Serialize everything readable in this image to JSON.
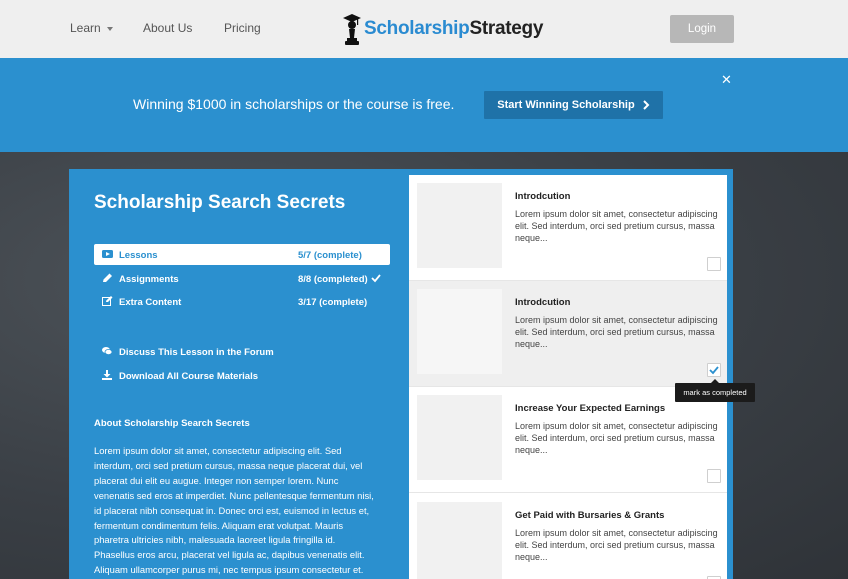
{
  "header": {
    "nav": [
      {
        "label": "Learn",
        "has_dropdown": true
      },
      {
        "label": "About Us"
      },
      {
        "label": "Pricing"
      }
    ],
    "logo_part1": "Scholarship",
    "logo_part2": "Strategy",
    "login_label": "Login"
  },
  "banner": {
    "text": "Winning $1000 in scholarships or the course is free.",
    "cta_label": "Start Winning Scholarship",
    "close_glyph": "✕"
  },
  "course": {
    "title": "Scholarship Search Secrets",
    "menu": [
      {
        "label": "Lessons",
        "count": "5/7 (complete)",
        "icon": "video-icon",
        "active": true
      },
      {
        "label": "Assignments",
        "count": "8/8 (completed)",
        "icon": "pencil-icon",
        "completed": true
      },
      {
        "label": "Extra Content",
        "count": "3/17 (complete)",
        "icon": "edit-icon"
      }
    ],
    "links": [
      {
        "label": "Discuss This Lesson in the Forum",
        "icon": "comments-icon"
      },
      {
        "label": "Download All Course Materials",
        "icon": "download-icon"
      }
    ],
    "about_title": "About Scholarship Search Secrets",
    "about_body": "Lorem ipsum dolor sit amet, consectetur adipiscing elit. Sed interdum, orci sed pretium cursus, massa neque placerat dui, vel placerat dui elit eu augue. Integer non semper lorem. Nunc venenatis sed eros at imperdiet. Nunc pellentesque fermentum nisi, id placerat nibh consequat in. Donec orci est, euismod in lectus et, fermentum condimentum felis. Aliquam erat volutpat. Mauris pharetra ultricies nibh, malesuada laoreet ligula fringilla id. Phasellus eros arcu, placerat vel ligula ac, dapibus venenatis elit. Aliquam ullamcorper purus mi, nec tempus ipsum consectetur et."
  },
  "lessons": [
    {
      "title": "Introdcution",
      "description": "Lorem ipsum dolor sit amet, consectetur adipiscing elit. Sed interdum, orci sed pretium cursus, massa neque...",
      "checked": false
    },
    {
      "title": "Introdcution",
      "description": "Lorem ipsum dolor sit amet, consectetur adipiscing elit. Sed interdum, orci sed pretium cursus, massa neque...",
      "checked": true
    },
    {
      "title": "Increase Your Expected Earnings",
      "description": "Lorem ipsum dolor sit amet, consectetur adipiscing elit. Sed interdum, orci sed pretium cursus, massa neque...",
      "checked": false
    },
    {
      "title": "Get Paid with Bursaries & Grants",
      "description": "Lorem ipsum dolor sit amet, consectetur adipiscing elit. Sed interdum, orci sed pretium cursus, massa neque...",
      "checked": false
    }
  ],
  "tooltip": {
    "text": "mark as completed"
  },
  "colors": {
    "brand_blue": "#2b90cf",
    "banner_button": "#1f72a8",
    "header_bg": "#efefef",
    "login_bg": "#b7b7b7",
    "board_bg": "#3a4046"
  }
}
